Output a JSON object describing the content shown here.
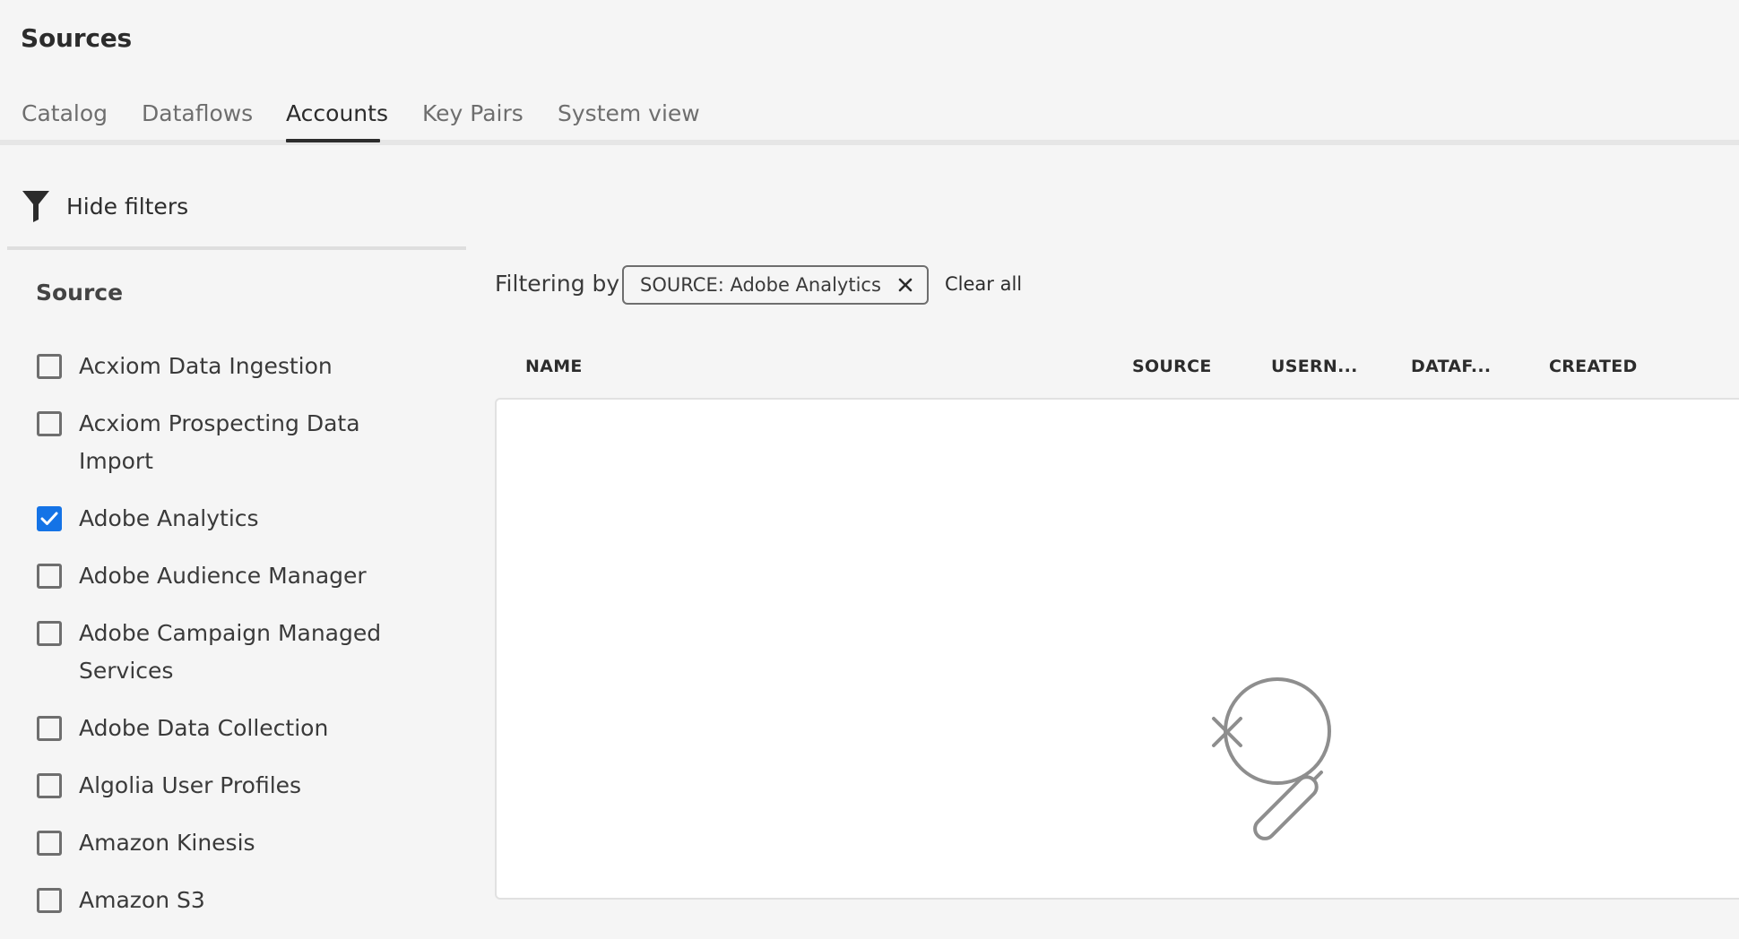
{
  "page": {
    "title": "Sources"
  },
  "tabs": [
    {
      "label": "Catalog",
      "selected": false
    },
    {
      "label": "Dataflows",
      "selected": false
    },
    {
      "label": "Accounts",
      "selected": true
    },
    {
      "label": "Key Pairs",
      "selected": false
    },
    {
      "label": "System view",
      "selected": false
    }
  ],
  "filters": {
    "toggle_label": "Hide filters",
    "toggle_icon": "filter-icon",
    "facet_heading": "Source",
    "items": [
      {
        "label": "Acxiom Data Ingestion",
        "checked": false
      },
      {
        "label": "Acxiom Prospecting Data Import",
        "checked": false
      },
      {
        "label": "Adobe Analytics",
        "checked": true
      },
      {
        "label": "Adobe Audience Manager",
        "checked": false
      },
      {
        "label": "Adobe Campaign Managed Services",
        "checked": false
      },
      {
        "label": "Adobe Data Collection",
        "checked": false
      },
      {
        "label": "Algolia User Profiles",
        "checked": false
      },
      {
        "label": "Amazon Kinesis",
        "checked": false
      },
      {
        "label": "Amazon S3",
        "checked": false
      }
    ]
  },
  "active_filters": {
    "label": "Filtering by",
    "tags": [
      {
        "label": "SOURCE: Adobe Analytics",
        "remove_icon": "close-icon"
      }
    ],
    "clear_all_label": "Clear all"
  },
  "table": {
    "columns": [
      "NAME",
      "SOURCE",
      "USERN...",
      "DATAF...",
      "CREATED"
    ],
    "rows": [],
    "empty_state_icon": "no-results-search-icon"
  },
  "colors": {
    "accent": "#1473e6",
    "background": "#f5f5f5",
    "text": "#2c2c2c",
    "muted_text": "#6e6e6e",
    "illustration": "#8e8e8e"
  }
}
